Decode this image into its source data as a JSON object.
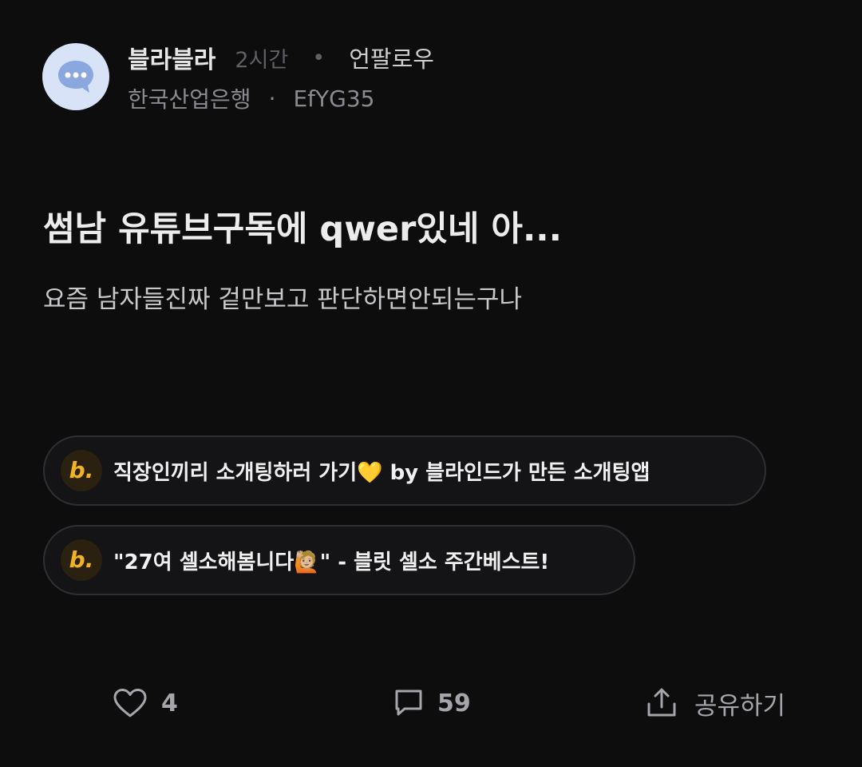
{
  "post": {
    "author": "블라블라",
    "time": "2시간",
    "separator": "•",
    "follow_label": "언팔로우",
    "company": "한국산업은행",
    "meta_separator": "·",
    "user_id": "EfYG35",
    "title": "썸남 유튜브구독에 qwer있네 아...",
    "body": "요즘 남자들진짜 겉만보고 판단하면안되는구나"
  },
  "promos": [
    {
      "text": "직장인끼리 소개팅하러 가기💛 by 블라인드가 만든 소개팅앱",
      "badge": "b."
    },
    {
      "text": "\"27여 셀소해봄니다🙋🏼\" - 블릿 셀소 주간베스트!",
      "badge": "b."
    }
  ],
  "actions": {
    "likes": "4",
    "comments": "59",
    "share_label": "공유하기"
  },
  "colors": {
    "background": "#0d0d0e",
    "avatar_bg": "#d8e3f8",
    "avatar_icon": "#8aa7e0",
    "brand_accent": "#f0b323"
  },
  "icons": {
    "avatar": "chat-bubble-icon",
    "like": "heart-icon",
    "comment": "comment-icon",
    "share": "share-icon",
    "promo": "blind-b-logo"
  }
}
